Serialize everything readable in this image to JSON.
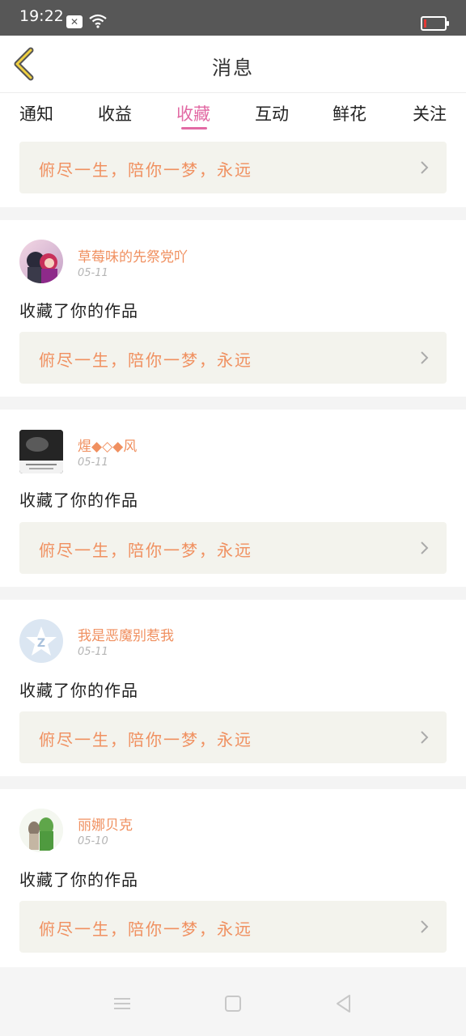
{
  "status_bar": {
    "time": "19:22"
  },
  "header": {
    "title": "消息"
  },
  "tabs": [
    {
      "label": "通知"
    },
    {
      "label": "收益"
    },
    {
      "label": "收藏",
      "active": true
    },
    {
      "label": "互动"
    },
    {
      "label": "鲜花"
    },
    {
      "label": "关注"
    }
  ],
  "colors": {
    "accent": "#e26aa4",
    "orange_text": "#f09060",
    "card_bg": "#f3f3ed"
  },
  "work_title": "俯尽一生，陪你一梦，永远",
  "action_text": "收藏了你的作品",
  "notifications": [
    {
      "username": "草莓味的先祭党吖",
      "date": "05-11"
    },
    {
      "username": "煋◆◇◆风",
      "date": "05-11"
    },
    {
      "username": "我是恶魔别惹我",
      "date": "05-11"
    },
    {
      "username": "丽娜贝克",
      "date": "05-10"
    }
  ]
}
